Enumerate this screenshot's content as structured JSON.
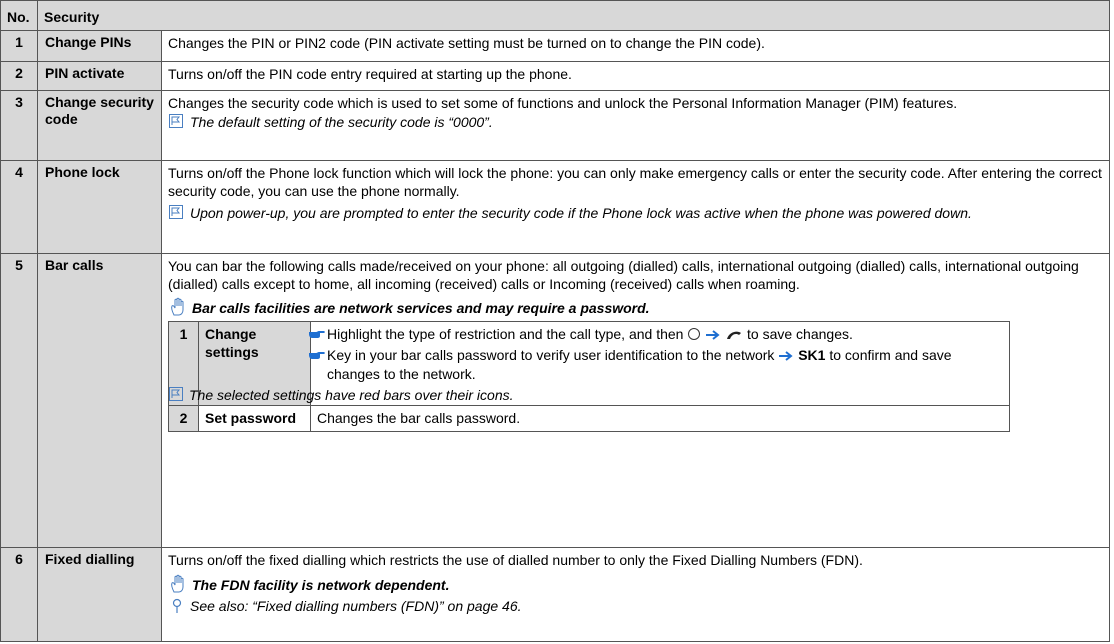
{
  "header": {
    "no": "No.",
    "title": "Security"
  },
  "rows": [
    {
      "num": "1",
      "name": "Change PINs",
      "desc": "Changes the PIN or PIN2 code (PIN activate setting must be turned on to change the PIN code)."
    },
    {
      "num": "2",
      "name": "PIN activate",
      "desc": "Turns on/off the PIN code entry required at starting up the phone."
    },
    {
      "num": "3",
      "name": "Change security code",
      "desc": "Changes the security code which is used to set some of functions and unlock the Personal Information Manager (PIM) features.",
      "note": "The default setting of the security code is “0000”."
    },
    {
      "num": "4",
      "name": "Phone lock",
      "desc": "Turns on/off the Phone lock function which will lock the phone: you can only make emergency calls or enter the security code. After entering the correct security code, you can use the phone normally.",
      "note": "Upon power-up, you are prompted to enter the security code if the Phone lock was active when the phone was powered down."
    },
    {
      "num": "5",
      "name": "Bar calls",
      "desc": "You can bar the following calls made/received on your phone: all outgoing (dialled) calls, international outgoing (dialled) calls, international outgoing (dialled) calls except to home, all incoming (received) calls or Incoming (received) calls when roaming.",
      "warning": "Bar calls facilities are network services and may require a password.",
      "subrows": [
        {
          "num": "1",
          "name": "Change settings",
          "bullet1_a": "Highlight the type of restriction and the call type, and then",
          "bullet1_b": "to save changes.",
          "bullet2_a": "Key in your bar calls password to verify user identification to the network",
          "bullet2_key": "SK1",
          "bullet2_b": "to confirm and save changes to the network.",
          "note": "The selected settings have red bars over their icons."
        },
        {
          "num": "2",
          "name": "Set password",
          "desc": "Changes the bar calls password."
        }
      ]
    },
    {
      "num": "6",
      "name": "Fixed dialling",
      "desc": "Turns on/off the fixed dialling which restricts the use of dialled number to only the Fixed Dialling Numbers (FDN).",
      "warning": "The FDN facility is network dependent.",
      "see": "See also: “Fixed dialling numbers (FDN)” on page 46."
    }
  ],
  "icons": {
    "note": "note-flag-icon",
    "warning": "hand-warning-icon",
    "see_also": "pushpin-icon",
    "bullet": "pointing-hand-icon",
    "arrow": "arrow-right-icon",
    "ok_key": "ok-key-icon",
    "send_key": "send-key-icon"
  },
  "colors": {
    "header_bg": "#d8d8d8",
    "arrow": "#1f6fd1",
    "icon": "#4a7fc1"
  }
}
